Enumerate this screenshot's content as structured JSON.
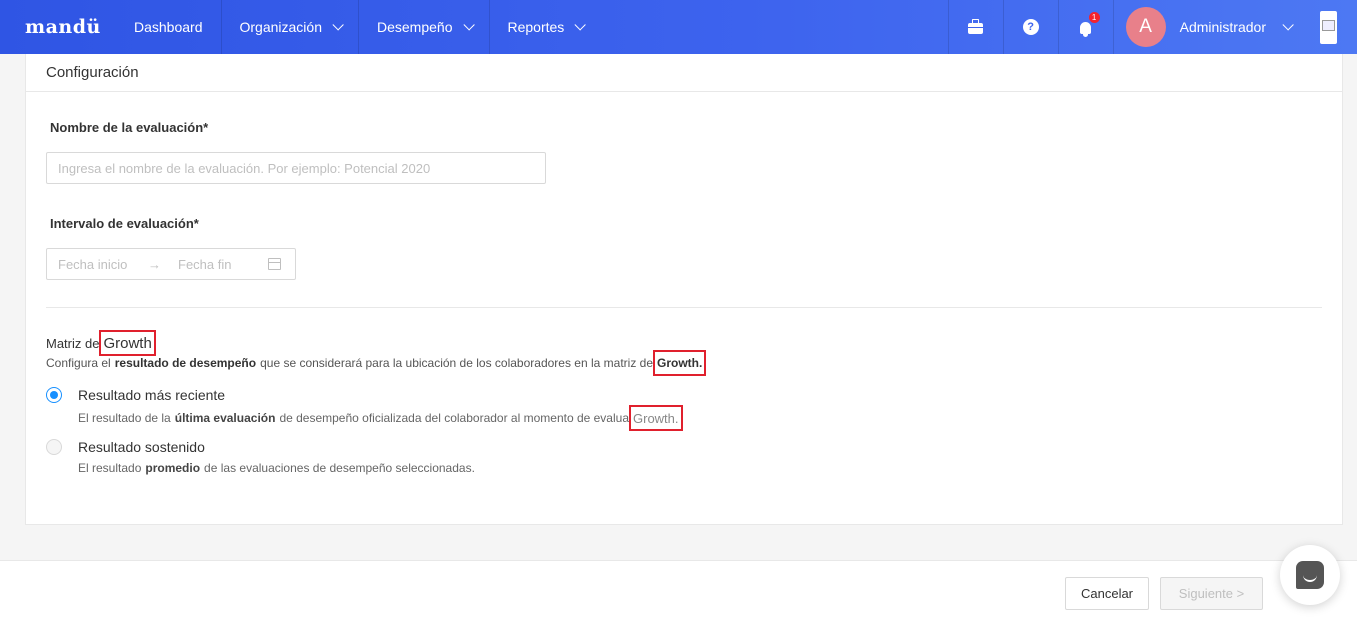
{
  "navbar": {
    "logo": "mandü",
    "items": [
      {
        "label": "Dashboard"
      },
      {
        "label": "Organización"
      },
      {
        "label": "Desempeño"
      },
      {
        "label": "Reportes"
      }
    ],
    "notifications_count": "1",
    "user": {
      "initial": "A",
      "name": "Administrador"
    }
  },
  "card": {
    "header": "Configuración",
    "name_label": "Nombre de la evaluación*",
    "name_placeholder": "Ingresa el nombre de la evaluación. Por ejemplo: Potencial 2020",
    "interval_label": "Intervalo de evaluación*",
    "interval_start_placeholder": "Fecha inicio",
    "interval_end_placeholder": "Fecha fin",
    "matrix": {
      "title_prefix": "Matriz de",
      "title_highlight": "Growth",
      "desc_before": "Configura el",
      "desc_bold": "resultado de desempeño",
      "desc_after": "que se considerará para la ubicación de los colaboradores en la matriz de",
      "desc_highlight": "Growth."
    },
    "options": [
      {
        "title": "Resultado más reciente",
        "desc_before": "El resultado de la",
        "desc_bold": "última evaluación",
        "desc_after": "de desempeño oficializada del colaborador al momento de evalua",
        "desc_highlight": "Growth.",
        "selected": true
      },
      {
        "title": "Resultado sostenido",
        "desc_before": "El resultado",
        "desc_bold": "promedio",
        "desc_after": "de las evaluaciones de desempeño seleccionadas.",
        "selected": false
      }
    ]
  },
  "footer": {
    "cancel_label": "Cancelar",
    "next_label": "Siguiente >"
  },
  "colors": {
    "nav_gradient_start": "#2f55e4",
    "nav_gradient_end": "#4d78f3",
    "radio_selected": "#1890ff",
    "highlight_box": "#e0202d"
  },
  "icons": [
    "briefcase-icon",
    "help-icon",
    "bell-icon",
    "chevron-down-icon",
    "calendar-icon",
    "chat-icon"
  ]
}
